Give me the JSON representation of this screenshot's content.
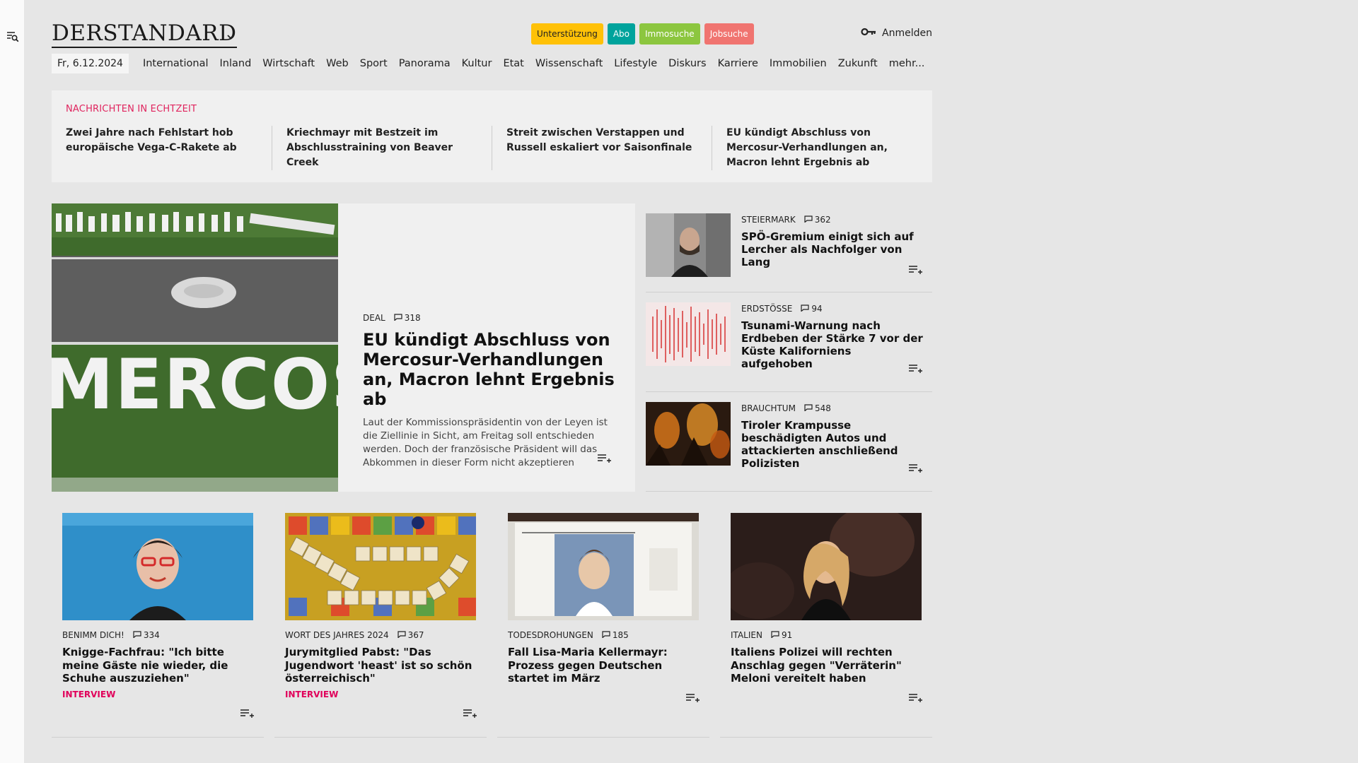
{
  "header": {
    "logo": "DERSTANDARD",
    "pills": [
      {
        "label": "Unterstützung",
        "color": "#ffc107"
      },
      {
        "label": "Abo",
        "color": "#00a39c"
      },
      {
        "label": "Immosuche",
        "color": "#8cc63f"
      },
      {
        "label": "Jobsuche",
        "color": "#f07470"
      }
    ],
    "login_label": "Anmelden"
  },
  "nav": {
    "date": "Fr, 6.12.2024",
    "items": [
      "International",
      "Inland",
      "Wirtschaft",
      "Web",
      "Sport",
      "Panorama",
      "Kultur",
      "Etat",
      "Wissenschaft",
      "Lifestyle",
      "Diskurs",
      "Karriere",
      "Immobilien",
      "Zukunft",
      "mehr..."
    ]
  },
  "ticker": {
    "label": "NACHRICHTEN IN ECHTZEIT",
    "items": [
      "Zwei Jahre nach Fehlstart hob euro­päische Vega-C-Rakete ab",
      "Kriechmayr mit Bestzeit im Abschluss­training von Beaver Creek",
      "Streit zwischen Verstappen und Rus­sell eskaliert vor Saisonfinale",
      "EU kündigt Abschluss von Mercosur-Verhandlungen an, Macron lehnt Er­gebnis ab"
    ]
  },
  "lead": {
    "kicker": "DEAL",
    "comments": "318",
    "title": "EU kündigt Abschluss von Mercosur-Verhandlungen an, Macron lehnt Ergebnis ab",
    "teaser": "Laut der Kommissionspräsidentin von der Leyen ist die Ziellinie in Sicht, am Freitag soll entschieden werden. Doch der französische Präsident will das Abkommen in dieser Form nicht akzeptieren",
    "image_text": "MERCOSUR"
  },
  "side": [
    {
      "kicker": "STEIERMARK",
      "comments": "362",
      "title": "SPÖ-Gremium einigt sich auf Lercher als Nachfolger von Lang"
    },
    {
      "kicker": "ERDSTÖSSE",
      "comments": "94",
      "title": "Tsunami-Warnung nach Erdbeben der Stärke 7 vor der Küste Kaliforniens aufgehoben"
    },
    {
      "kicker": "BRAUCHTUM",
      "comments": "548",
      "title": "Tiroler Krampusse beschädigten Autos und attackierten anschließend Polizisten"
    }
  ],
  "cards": [
    {
      "kicker": "BENIMM DICH!",
      "comments": "334",
      "title": "Knigge-Fachfrau: \"Ich bitte meine Gäste nie wieder, die Schuhe auszuziehen\"",
      "tag": "INTERVIEW"
    },
    {
      "kicker": "WORT DES JAHRES 2024",
      "comments": "367",
      "title": "Jurymitglied Pabst: \"Das Jugendwort 'heast' ist so schön ös­terreichisch\"",
      "tag": "INTERVIEW"
    },
    {
      "kicker": "TODESDROHUNGEN",
      "comments": "185",
      "title": "Fall Lisa-Maria Kellermayr: Prozess gegen Deutschen startet im März",
      "tag": ""
    },
    {
      "kicker": "ITALIEN",
      "comments": "91",
      "title": "Italiens Polizei will rechten Anschlag gegen \"Verräterin\" Meloni vereitelt haben",
      "tag": ""
    }
  ],
  "colors": {
    "accent_red": "#e0245e",
    "interview_pink": "#e0005a",
    "panel_bg": "#f0f0f0",
    "page_bg": "#e6e6e6"
  }
}
